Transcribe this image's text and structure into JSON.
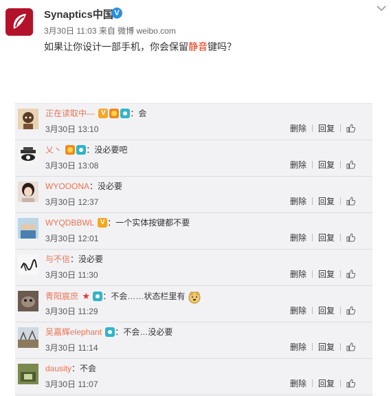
{
  "post": {
    "author": "Synaptics中国",
    "meta": "3月30日 11:03 来自 微博 weibo.com",
    "text_before": "如果让你设计一部手机，你会保留",
    "text_highlight": "静音",
    "text_after": "键吗？"
  },
  "actions": {
    "delete": "删除",
    "reply": "回复"
  },
  "comments": [
    {
      "user": "正在读取中---",
      "text": "：会",
      "time": "3月30日 13:10"
    },
    {
      "user": "乂丶",
      "text": "：没必要吧",
      "time": "3月30日 13:08"
    },
    {
      "user": "WYOOONA",
      "text": "：没必要",
      "time": "3月30日 12:37"
    },
    {
      "user": "WYQDBBWL",
      "text": "：一个实体按键都不要",
      "time": "3月30日 12:01"
    },
    {
      "user": "与不信",
      "text": "：没必要",
      "time": "3月30日 11:30"
    },
    {
      "user": "青阳宸庶",
      "text": "：不会……状态栏里有",
      "time": "3月30日 11:29"
    },
    {
      "user": "吴嘉辉elephant",
      "text": "：不会…没必要",
      "time": "3月30日 11:14"
    },
    {
      "user": "dausity",
      "text": "：不会",
      "time": "3月30日 11:07"
    }
  ],
  "icons": {
    "verified": "verified-icon",
    "chevron": "chevron-down-icon",
    "like": "thumbs-up-icon",
    "member_badge": "v-badge-icon",
    "camera_badge": "camera-badge-icon",
    "star_badge": "star-icon",
    "emoji": "doge-emoji-icon"
  },
  "colors": {
    "username": "#eb7350",
    "highlight": "#e3300d",
    "comment_bg": "#f2f2f5",
    "brand": "#b3122b"
  }
}
